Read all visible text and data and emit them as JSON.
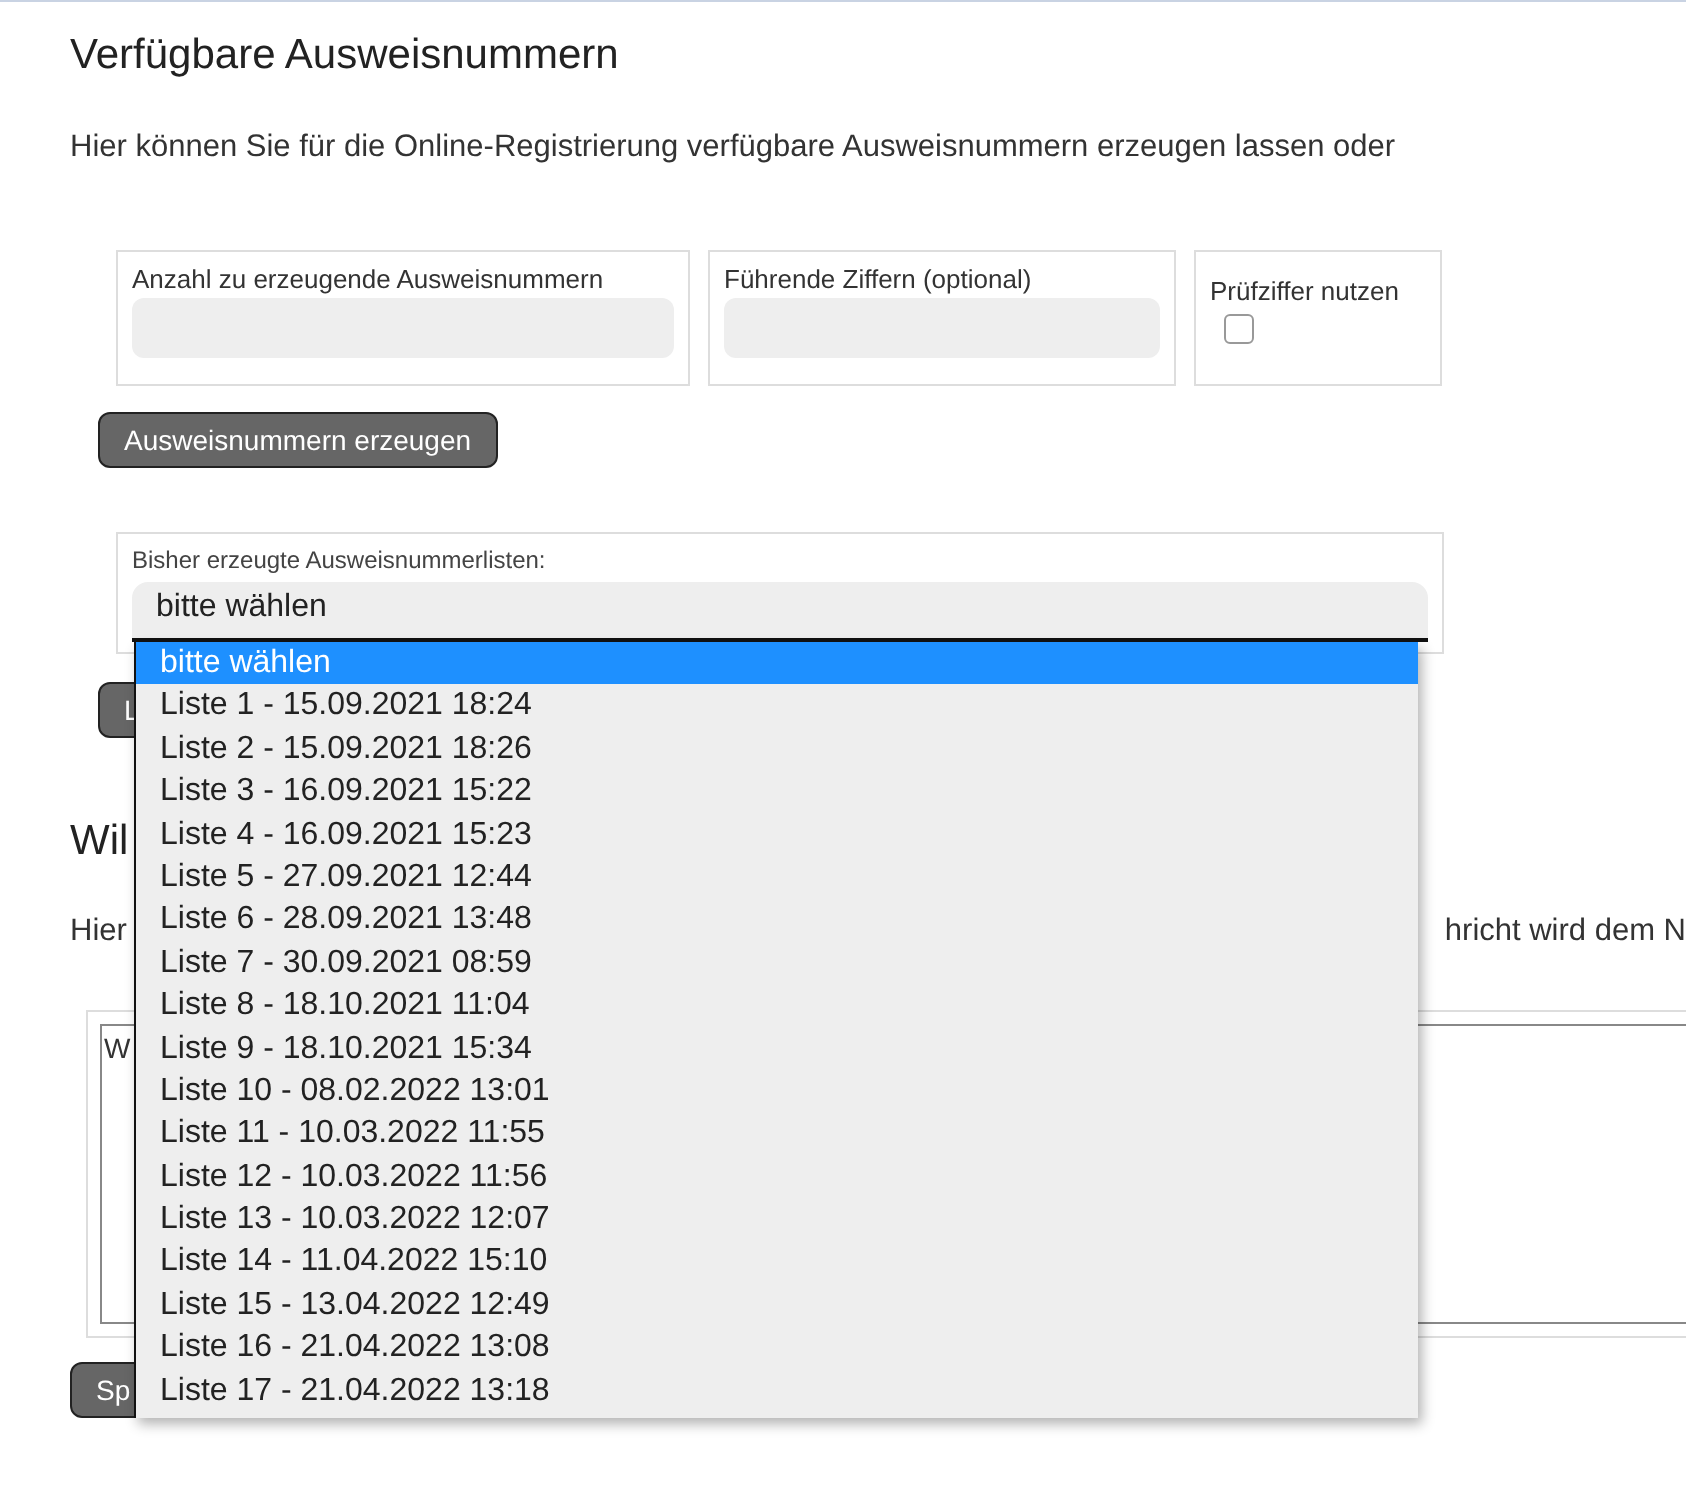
{
  "title": "Verfügbare Ausweisnummern",
  "description": "Hier können Sie für die Online-Registrierung verfügbare Ausweisnummern erzeugen lassen oder",
  "fields": [
    {
      "kind": "text",
      "label": "Anzahl zu erzeugende Ausweisnummern"
    },
    {
      "kind": "text",
      "label": "Führende Ziffern (optional)"
    },
    {
      "kind": "checkbox",
      "label": "Prüfziffer nutzen",
      "checked": false
    }
  ],
  "generate_button": "Ausweisnummern erzeugen",
  "list_select": {
    "label": "Bisher erzeugte Ausweisnummerlisten:",
    "value": "bitte wählen",
    "expanded": true,
    "options": [
      {
        "label": "bitte wählen",
        "selected": true
      },
      {
        "label": "Liste 1 - 15.09.2021 18:24",
        "selected": false
      },
      {
        "label": "Liste 2 - 15.09.2021 18:26",
        "selected": false
      },
      {
        "label": "Liste 3 - 16.09.2021 15:22",
        "selected": false
      },
      {
        "label": "Liste 4 - 16.09.2021 15:23",
        "selected": false
      },
      {
        "label": "Liste 5 - 27.09.2021 12:44",
        "selected": false
      },
      {
        "label": "Liste 6 - 28.09.2021 13:48",
        "selected": false
      },
      {
        "label": "Liste 7 - 30.09.2021 08:59",
        "selected": false
      },
      {
        "label": "Liste 8 - 18.10.2021 11:04",
        "selected": false
      },
      {
        "label": "Liste 9 - 18.10.2021 15:34",
        "selected": false
      },
      {
        "label": "Liste 10 - 08.02.2022 13:01",
        "selected": false
      },
      {
        "label": "Liste 11 - 10.03.2022 11:55",
        "selected": false
      },
      {
        "label": "Liste 12 - 10.03.2022 11:56",
        "selected": false
      },
      {
        "label": "Liste 13 - 10.03.2022 12:07",
        "selected": false
      },
      {
        "label": "Liste 14 - 11.04.2022 15:10",
        "selected": false
      },
      {
        "label": "Liste 15 - 13.04.2022 12:49",
        "selected": false
      },
      {
        "label": "Liste 16 - 21.04.2022 13:08",
        "selected": false
      },
      {
        "label": "Liste 17 - 21.04.2022 13:18",
        "selected": false
      }
    ]
  },
  "covered": {
    "list_button": "L",
    "heading": "Wil",
    "paragraph_start": "Hier",
    "paragraph_end": "hricht wird dem N",
    "textarea_value": "W",
    "save_button": "Sp"
  }
}
